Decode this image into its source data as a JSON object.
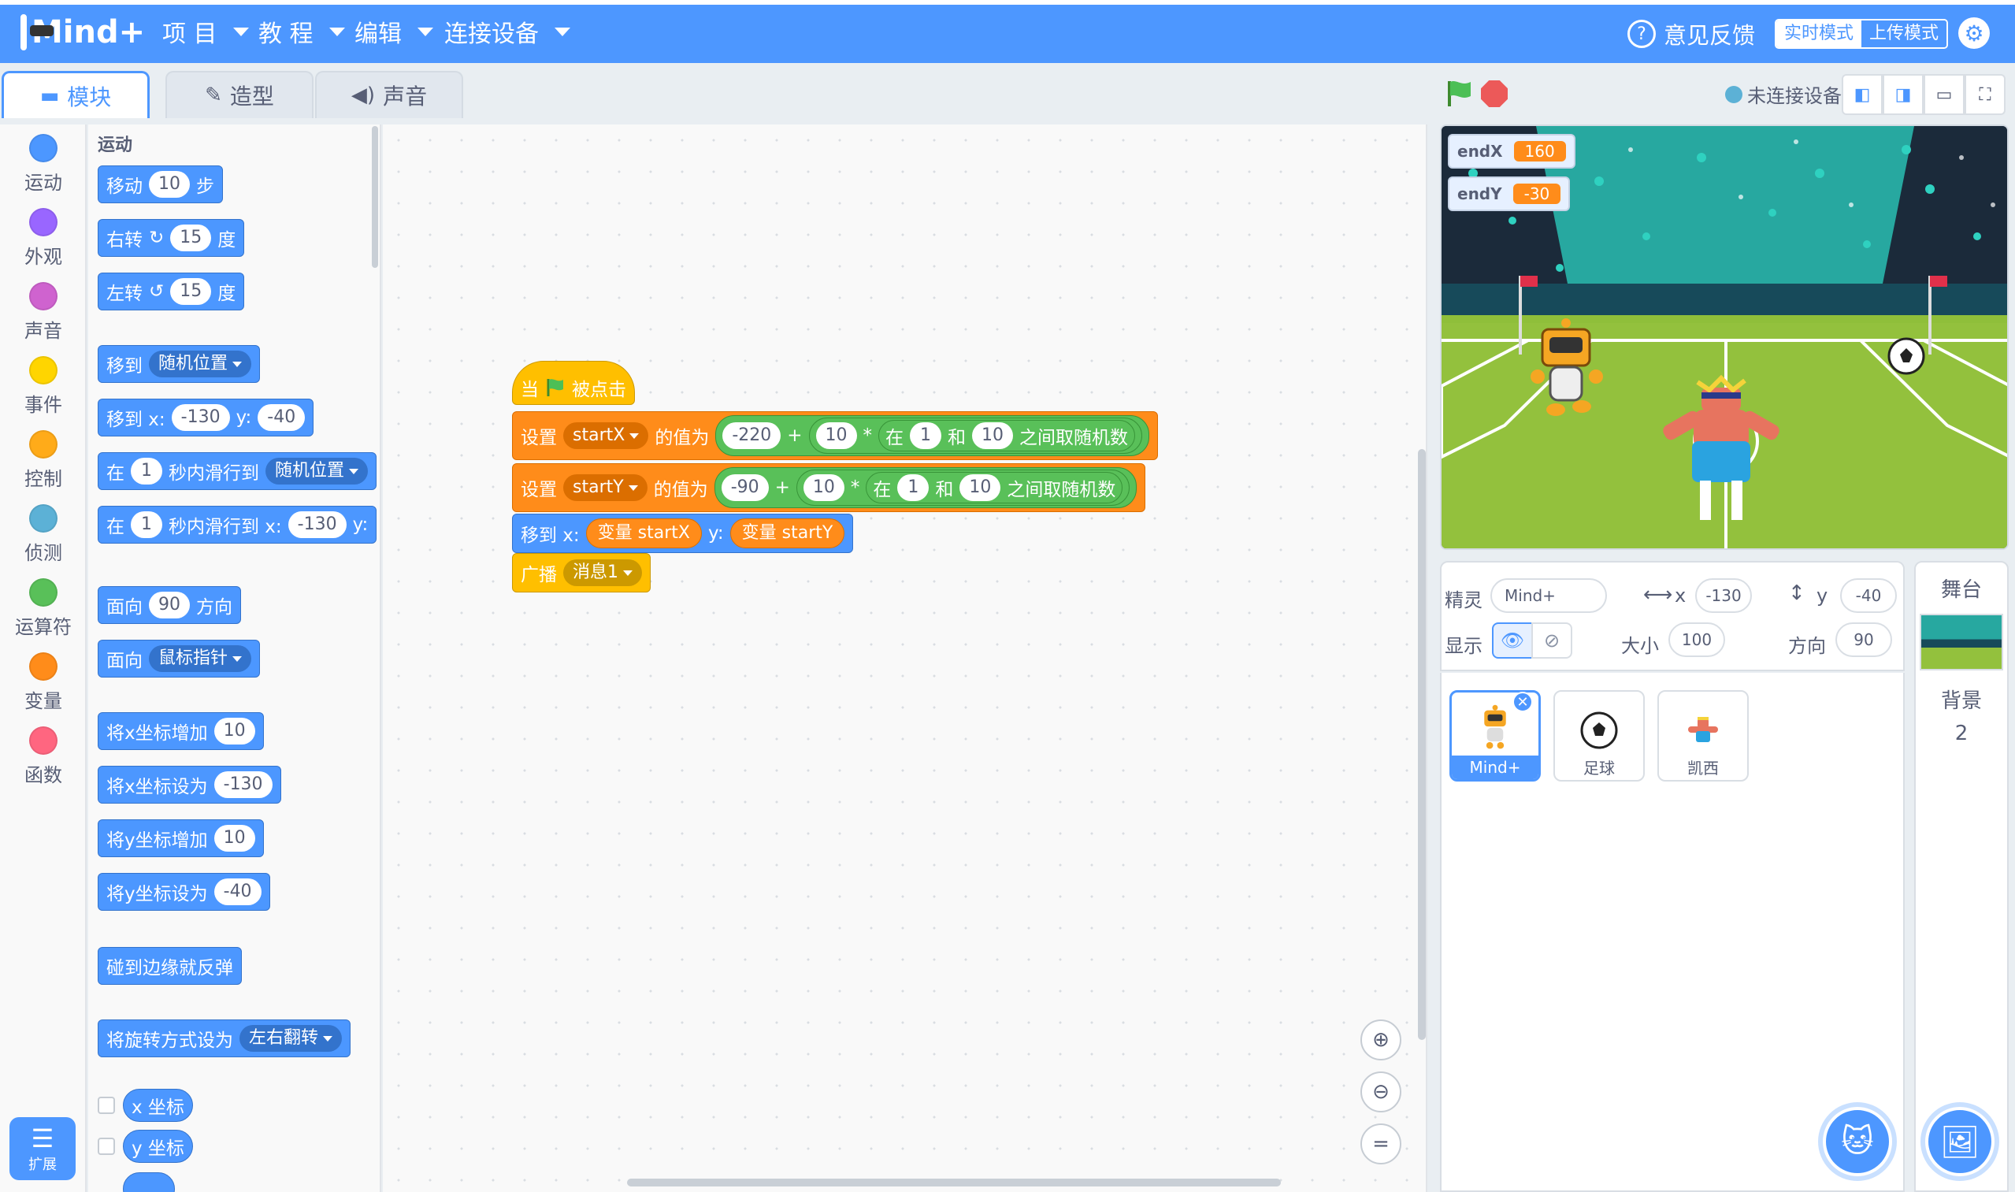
{
  "app": {
    "logo_text": "Mind+"
  },
  "menu": {
    "project": "项 目",
    "tutorial": "教 程",
    "edit": "编辑",
    "connect": "连接设备",
    "feedback": "意见反馈",
    "mode_realtime": "实时模式",
    "mode_upload": "上传模式"
  },
  "tabs": {
    "blocks": "模块",
    "costumes": "造型",
    "sounds": "声音"
  },
  "categories": [
    {
      "label": "运动",
      "color": "#4c97ff"
    },
    {
      "label": "外观",
      "color": "#9966ff"
    },
    {
      "label": "声音",
      "color": "#cf63cf"
    },
    {
      "label": "事件",
      "color": "#ffd500"
    },
    {
      "label": "控制",
      "color": "#ffab19"
    },
    {
      "label": "侦测",
      "color": "#5cb1d6"
    },
    {
      "label": "运算符",
      "color": "#59c059"
    },
    {
      "label": "变量",
      "color": "#ff8c1a"
    },
    {
      "label": "函数",
      "color": "#ff6680"
    }
  ],
  "extension_label": "扩展",
  "palette": {
    "section": "运动",
    "move": {
      "pre": "移动",
      "val": "10",
      "post": "步"
    },
    "turn_right": {
      "pre": "右转",
      "val": "15",
      "post": "度"
    },
    "turn_left": {
      "pre": "左转",
      "val": "15",
      "post": "度"
    },
    "goto": {
      "pre": "移到",
      "drop": "随机位置"
    },
    "goto_xy": {
      "pre": "移到 x:",
      "x": "-130",
      "ylbl": "y:",
      "y": "-40"
    },
    "glide": {
      "pre": "在",
      "val": "1",
      "mid": "秒内滑行到",
      "drop": "随机位置"
    },
    "glide_xy": {
      "pre": "在",
      "val": "1",
      "mid": "秒内滑行到 x:",
      "x": "-130",
      "ylbl": "y:"
    },
    "point_dir": {
      "pre": "面向",
      "val": "90",
      "post": "方向"
    },
    "point_towards": {
      "pre": "面向",
      "drop": "鼠标指针"
    },
    "change_x": {
      "pre": "将x坐标增加",
      "val": "10"
    },
    "set_x": {
      "pre": "将x坐标设为",
      "val": "-130"
    },
    "change_y": {
      "pre": "将y坐标增加",
      "val": "10"
    },
    "set_y": {
      "pre": "将y坐标设为",
      "val": "-40"
    },
    "bounce": "碰到边缘就反弹",
    "rotation": {
      "pre": "将旋转方式设为",
      "drop": "左右翻转"
    },
    "xpos": "x 坐标",
    "ypos": "y 坐标"
  },
  "script": {
    "hat": {
      "pre": "当",
      "post": "被点击"
    },
    "set1": {
      "pre": "设置",
      "var": "startX",
      "mid": "的值为",
      "a": "-220",
      "plus": "+",
      "b": "10",
      "mul": "*",
      "r_pre": "在",
      "r_from": "1",
      "r_and": "和",
      "r_to": "10",
      "r_post": "之间取随机数"
    },
    "set2": {
      "pre": "设置",
      "var": "startY",
      "mid": "的值为",
      "a": "-90",
      "plus": "+",
      "b": "10",
      "mul": "*",
      "r_pre": "在",
      "r_from": "1",
      "r_and": "和",
      "r_to": "10",
      "r_post": "之间取随机数"
    },
    "goto": {
      "pre": "移到 x:",
      "x": "变量 startX",
      "ylbl": "y:",
      "y": "变量 startY"
    },
    "broadcast": {
      "pre": "广播",
      "drop": "消息1"
    }
  },
  "stage_header": {
    "device_status": "未连接设备"
  },
  "monitors": [
    {
      "name": "endX",
      "value": "160"
    },
    {
      "name": "endY",
      "value": "-30"
    }
  ],
  "sprite_info": {
    "sprite_label": "精灵",
    "sprite_name": "Mind+",
    "x_label": "x",
    "x": "-130",
    "y_label": "y",
    "y": "-40",
    "show_label": "显示",
    "size_label": "大小",
    "size": "100",
    "direction_label": "方向",
    "direction": "90"
  },
  "sprites": [
    {
      "name": "Mind+",
      "selected": true
    },
    {
      "name": "足球",
      "selected": false
    },
    {
      "name": "凯西",
      "selected": false
    }
  ],
  "stage_panel": {
    "title": "舞台",
    "backdrop_label": "背景",
    "backdrop_count": "2"
  },
  "colors": {
    "accent": "#4d97ff",
    "motion": "#4c97ff",
    "variables": "#ff8c1a",
    "events": "#ffbf00",
    "operators": "#59c059"
  }
}
